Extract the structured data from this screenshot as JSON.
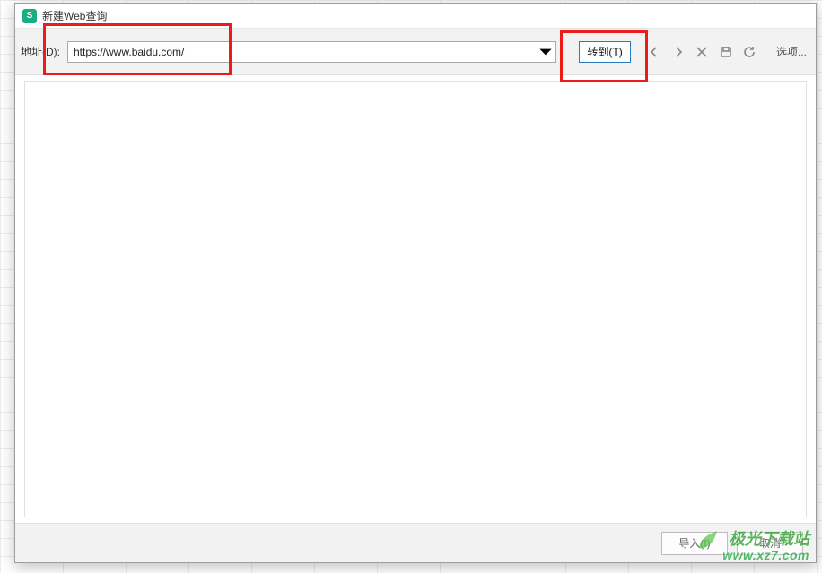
{
  "dialog": {
    "title": "新建Web查询",
    "app_icon_letter": "S"
  },
  "toolbar": {
    "address_label": "地址(D):",
    "address_value": "https://www.baidu.com/",
    "go_label": "转到(T)",
    "options_label": "选项..."
  },
  "footer": {
    "import_label": "导入(I)",
    "cancel_label": "取消"
  },
  "watermark": {
    "line1": "极光下载站",
    "line2": "www.xz7.com"
  }
}
